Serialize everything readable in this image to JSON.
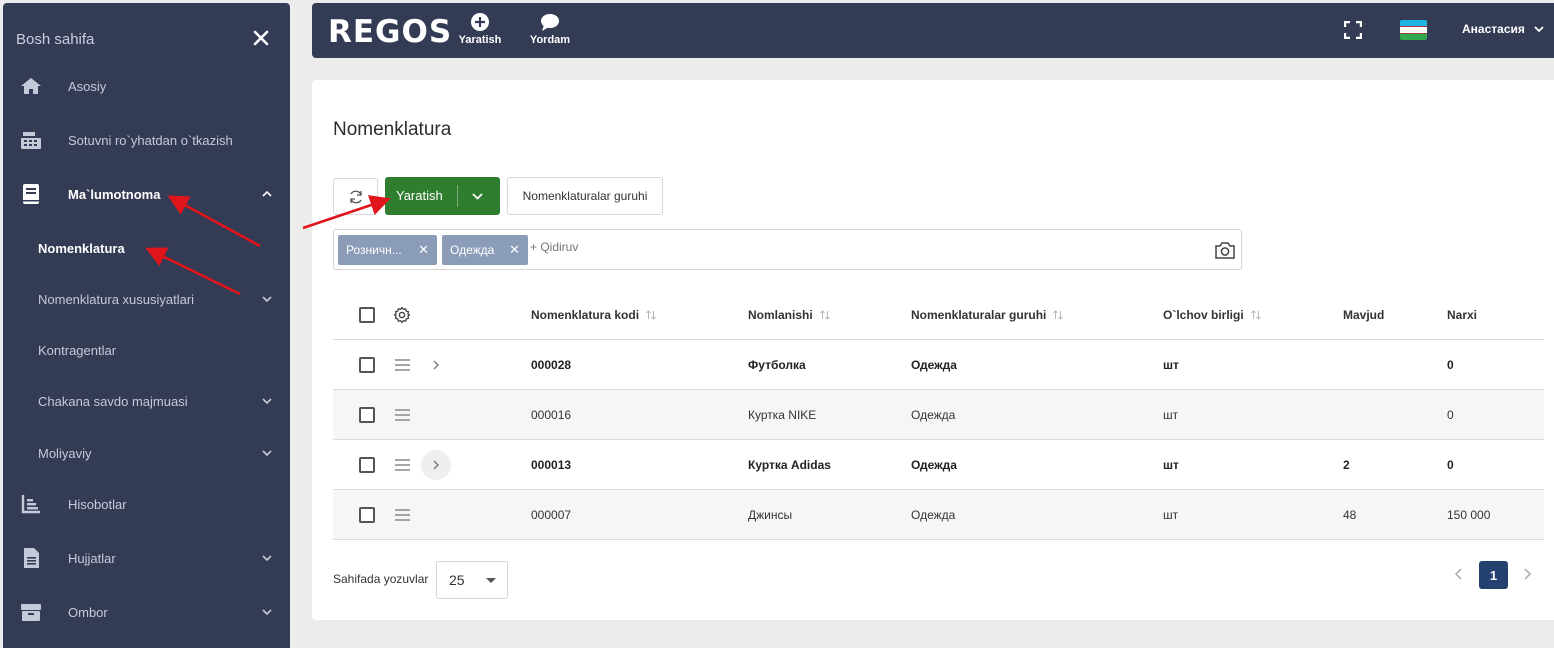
{
  "sidebar": {
    "header": "Bosh sahifa",
    "items": [
      {
        "label": "Asosiy"
      },
      {
        "label": "Sotuvni ro`yhatdan o`tkazish"
      },
      {
        "label": "Ma`lumotnoma"
      },
      {
        "label": "Nomenklatura"
      },
      {
        "label": "Nomenklatura xususiyatlari"
      },
      {
        "label": "Kontragentlar"
      },
      {
        "label": "Chakana savdo majmuasi"
      },
      {
        "label": "Moliyaviy"
      },
      {
        "label": "Hisobotlar"
      },
      {
        "label": "Hujjatlar"
      },
      {
        "label": "Ombor"
      }
    ]
  },
  "topbar": {
    "logo": "REGOS",
    "create_label": "Yaratish",
    "help_label": "Yordam",
    "user_name": "Анастасия"
  },
  "page": {
    "title": "Nomenklatura",
    "create_button": "Yaratish",
    "groups_button": "Nomenklaturalar guruhi",
    "filters": [
      "Розничн...",
      "Одежда"
    ],
    "search_placeholder": "+ Qidiruv"
  },
  "table": {
    "columns": [
      "Nomenklatura kodi",
      "Nomlanishi",
      "Nomenklaturalar guruhi",
      "O`lchov birligi",
      "Mavjud",
      "Narxi"
    ],
    "rows": [
      {
        "code": "000028",
        "name": "Футболка",
        "group": "Одежда",
        "unit": "шт",
        "stock": "",
        "price": "0"
      },
      {
        "code": "000016",
        "name": "Куртка NIKE",
        "group": "Одежда",
        "unit": "шт",
        "stock": "",
        "price": "0"
      },
      {
        "code": "000013",
        "name": "Куртка Adidas",
        "group": "Одежда",
        "unit": "шт",
        "stock": "2",
        "price": "0"
      },
      {
        "code": "000007",
        "name": "Джинсы",
        "group": "Одежда",
        "unit": "шт",
        "stock": "48",
        "price": "150 000"
      }
    ]
  },
  "footer": {
    "per_page_label": "Sahifada yozuvlar",
    "per_page_value": "25",
    "current_page": "1"
  },
  "colors": {
    "sidebar_bg": "#343b55",
    "primary_green": "#2f7d2f",
    "chip_bg": "#8b9cb9",
    "pagination_active": "#24406e",
    "annotation_arrow": "#e0151b"
  }
}
